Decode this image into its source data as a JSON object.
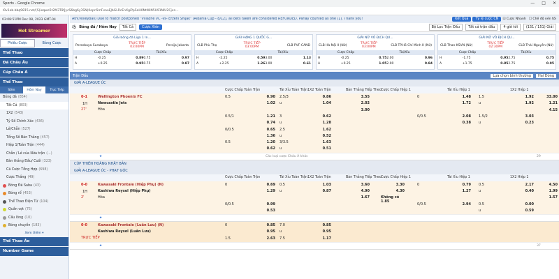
{
  "window": {
    "title": "Sports - Google Chrome",
    "controls": [
      "—",
      "□",
      "✕"
    ]
  },
  "url": "l0v1ob.bbq9815.net/(S(ieqwe5t2M3T8fjycS6bg6y3SN)0epn5mFxaoEJbGLRcEnXgiPpSaH0NtWiN5U91NlU2Cjxn...",
  "clock": "03:08:51PM Dec 08, 2023 GMT-04",
  "promo": "Hot Streamer",
  "left_tabs": [
    "Phiếu Cược",
    "Bảng Cược"
  ],
  "left_sections": [
    "Thể Thao",
    "Đá Châu Âu",
    "Cúp Châu Á"
  ],
  "sport_section": "Thể Thao",
  "sub_tabs": [
    "Sớm",
    "Hôm Nay",
    "Trực Tiếp"
  ],
  "sport_items": [
    {
      "label": "Bóng đá",
      "count": "(854)"
    },
    {
      "label": "Tất Cả",
      "count": "(803)"
    },
    {
      "label": "1X2",
      "count": "(543)"
    },
    {
      "label": "Tỷ Số Chính Xác",
      "count": "(436)"
    },
    {
      "label": "Lẻ/Chẵn",
      "count": "(527)"
    },
    {
      "label": "Tổng Số Bàn Thắng",
      "count": "(457)"
    },
    {
      "label": "Hiệp 1/Toàn Trận",
      "count": "(444)"
    },
    {
      "label": "Chẵn / Lẻ của Nửa trận",
      "count": "(...)"
    },
    {
      "label": "Bàn thắng Đầu/ Cuối",
      "count": "(323)"
    },
    {
      "label": "Cá Cược Tổng Hợp",
      "count": "(698)"
    },
    {
      "label": "Cược Thắng",
      "count": "(49)"
    }
  ],
  "other_sports": [
    {
      "label": "Bóng Đá Saba",
      "count": "(43)",
      "color": "#e05050"
    },
    {
      "label": "Bóng rổ",
      "count": "(453)",
      "color": "#e88a2a"
    },
    {
      "label": "Thể Thao Điện Tử",
      "count": "(104)",
      "color": "#555"
    },
    {
      "label": "Quần vợt",
      "count": "(75)",
      "color": "#cfd832"
    },
    {
      "label": "Cầu lông",
      "count": "(10)",
      "color": "#999"
    },
    {
      "label": "Bóng chuyền",
      "count": "(183)",
      "color": "#e0b030"
    }
  ],
  "see_more": "Xem thêm ▾",
  "bottom_sections": [
    "Thể Thao Ảo",
    "Number Game"
  ],
  "news": "Ath(Volleyball) Due to match postponed \"Villazne VC -vs- Erzeni Shijak\" (Albania Cup - 8/12), all bets taken are considered REFUNDED. Parlay counted as one (1). Thank you!",
  "news_buttons": {
    "results": "Kết Quả",
    "odds": "Tỷ lệ cược CN",
    "quick": "Cược Nhanh",
    "odds_mode": "Chế độ nền tối"
  },
  "header": {
    "title": "Bóng đá / Hôm Nay",
    "select": "Tất Cả",
    "button": "Cược Xiên",
    "filter": "Bộ Lọc Trận Đấu",
    "filter2": "Tất cả trận đấu",
    "timer": "4 giờ tới",
    "count": "(151 / 151) Giải"
  },
  "cards": [
    {
      "league": "Giải bóng đá Liga 1 In...",
      "home": "Persebaya Surabaya",
      "away": "Persija Jakarta",
      "status": "TRỰC TIẾP",
      "time": "03:00PM",
      "rows": [
        [
          "H",
          "-0.25",
          "0.89",
          "0.75",
          "0.97"
        ],
        [
          "A",
          "+0.25",
          "0.95",
          "0.75",
          "0.87"
        ]
      ]
    },
    {
      "league": "GIẢI HẠNG 1 QUỐC G...",
      "home": "CLB Phù Thọ",
      "away": "CLB PVF-CAND",
      "status": "TRỰC TIẾP",
      "time": "03:00PM",
      "rows": [
        [
          "H",
          "-2.25",
          "0.59",
          "3.00",
          "1.13"
        ],
        [
          "A",
          "+2.25",
          "1.26",
          "3.00",
          "0.61"
        ]
      ]
    },
    {
      "league": "GIẢI NỮ VÔ ĐỊCH QU...",
      "home": "CLB Hà Nội II (Nữ)",
      "away": "CLB TP.Hồ Chí Minh II (Nữ)",
      "status": "TRỰC TIẾP",
      "time": "03:00PM",
      "rows": [
        [
          "H",
          "-0.25",
          "0.75",
          "2.00",
          "0.96"
        ],
        [
          "A",
          "+0.25",
          "1.05",
          "2.00",
          "0.84"
        ]
      ]
    },
    {
      "league": "GIẢI NỮ VÔ ĐỊCH QU...",
      "home": "CLB Than KSVN (Nữ)",
      "away": "CLB Thái Nguyên (Nữ)",
      "status": "TRỰC TIẾP",
      "time": "02:30PM",
      "rows": [
        [
          "H",
          "-1.75",
          "0.95",
          "2.75",
          "0.75"
        ],
        [
          "A",
          "+1.75",
          "0.85",
          "2.75",
          "0.95"
        ]
      ]
    }
  ],
  "card_labels": {
    "hdp": "Cược Chấp",
    "ou": "Tài/Xỉu"
  },
  "table_bar": {
    "title": "Trận Đấu",
    "sort": "Lựa chọn bình thường",
    "view": "Hai Dòng"
  },
  "col_labels": [
    "Cược Chấp Toàn Trận",
    "Tài Xỉu Toàn Trận",
    "1X2 Toàn Trận",
    "Bàn Thắng Tiếp Theo",
    "Cược Chấp Hiệp 1",
    "Tài Xỉu Hiệp 1",
    "1X2 Hiệp 1"
  ],
  "leagues": [
    {
      "name": "GIẢI A-LEAGUE ÚC",
      "matches": [
        {
          "score": "0-1",
          "period": "1H",
          "minute": "27'",
          "home": "Wellington Phoenix FC",
          "away": "Newcastle Jets",
          "draw": "Hòa",
          "lines": [
            [
              "0.5",
              "0.90",
              "2.5/3",
              "0.86",
              "3.55",
              "",
              "0",
              "1.48",
              "1.5",
              "1.92",
              "33.00"
            ],
            [
              "",
              "1.02",
              "u",
              "1.04",
              "2.02",
              "",
              "",
              "1.72",
              "u",
              "1.92",
              "1.21"
            ],
            [
              "",
              "",
              "",
              "",
              "3.00",
              "",
              "",
              "",
              "",
              "",
              "4.15"
            ],
            [
              "0.5/1",
              "1.21",
              "3",
              "0.62",
              "",
              "",
              "0/0.5",
              "2.08",
              "1.5/2",
              "3.03",
              ""
            ],
            [
              "",
              "0.74",
              "u",
              "1.28",
              "",
              "",
              "",
              "0.38",
              "u",
              "0.23",
              ""
            ],
            [
              "0/0.5",
              "0.65",
              "2.5",
              "1.62",
              "",
              "",
              "",
              "",
              "",
              "",
              ""
            ],
            [
              "",
              "1.36",
              "u",
              "0.52",
              "",
              "",
              "",
              "",
              "",
              "",
              ""
            ],
            [
              "0.5",
              "1.20",
              "3/3.5",
              "1.63",
              "",
              "",
              "",
              "",
              "",
              "",
              ""
            ],
            [
              "",
              "0.62",
              "u",
              "0.51",
              "",
              "",
              "",
              "",
              "",
              "",
              ""
            ]
          ]
        }
      ],
      "foot": "Các loại cược Châu Á khác",
      "foot_count": "29"
    },
    {
      "name": "CÚP THIÊN HOÀNG NHẬT BẢN",
      "extra": "GIẢI A-LEAGUE ÚC - PHẠT GÓC",
      "matches": [
        {
          "score": "0-0",
          "period": "1H",
          "minute": "2'",
          "home": "Kawasaki Frontale (Hiệp Phụ) (N)",
          "away": "Kashiwa Reysol (Hiệp Phụ)",
          "draw": "Hòa",
          "lines": [
            [
              "0",
              "0.69",
              "0.5",
              "1.03",
              "3.60",
              "3.30",
              "0",
              "0.79",
              "0.5",
              "2.17",
              "4.50"
            ],
            [
              "",
              "1.29",
              "u",
              "0.87",
              "4.90",
              "4.30",
              "",
              "1.27",
              "u",
              "0.40",
              "1.99"
            ],
            [
              "",
              "",
              "",
              "",
              "1.67",
              "Không có 1.85",
              "",
              "",
              "",
              "",
              "1.57"
            ],
            [
              "0/0.5",
              "0.99",
              "",
              "",
              "",
              "",
              "0/0.5",
              "2.94",
              "0.5",
              "0.00",
              ""
            ],
            [
              "",
              "0.53",
              "",
              "",
              "",
              "",
              "",
              "",
              "u",
              "0.59",
              ""
            ]
          ]
        },
        {
          "score": "0-0",
          "period": "",
          "minute": "TRỰC TIẾP",
          "home": "Kawasaki Frontale (Luân Lưu) (N)",
          "away": "Kashiwa Reysol (Luân Lưu)",
          "draw": "",
          "lines": [
            [
              "0",
              "0.85",
              "7.0",
              "0.85",
              "",
              "",
              "",
              "",
              "",
              "",
              ""
            ],
            [
              "",
              "0.95",
              "u",
              "0.95",
              "",
              "",
              "",
              "",
              "",
              "",
              ""
            ],
            [
              "1.5",
              "2.63",
              "7.5",
              "1.17",
              "",
              "",
              "",
              "",
              "",
              "",
              ""
            ]
          ]
        }
      ],
      "foot": "",
      "foot_count": "37"
    }
  ]
}
